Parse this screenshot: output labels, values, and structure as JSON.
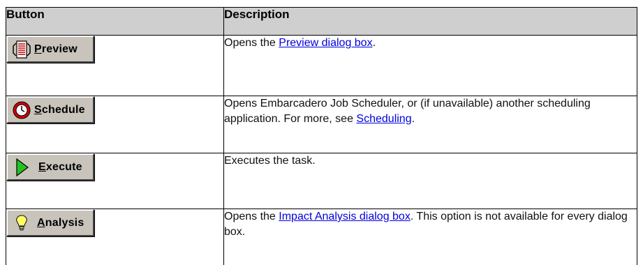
{
  "table": {
    "headers": {
      "button": "Button",
      "description": "Description"
    },
    "rows": [
      {
        "button_key": "P",
        "button_rest": "review",
        "icon": "preview-icon",
        "desc_before": "Opens the ",
        "desc_link": "Preview dialog box",
        "desc_after": "."
      },
      {
        "button_key": "S",
        "button_rest": "chedule",
        "icon": "clock-icon",
        "desc_before": "Opens Embarcadero Job Scheduler, or (if unavailable) another scheduling application. For more, see ",
        "desc_link": "Scheduling",
        "desc_after": "."
      },
      {
        "button_key": "E",
        "button_rest": "xecute",
        "icon": "play-icon",
        "desc_text": "Executes the task."
      },
      {
        "button_key": "A",
        "button_rest": "nalysis",
        "icon": "lightbulb-icon",
        "desc_before": "Opens the ",
        "desc_link": "Impact Analysis dialog box",
        "desc_after": ". This option is not available for every dialog box."
      }
    ]
  },
  "colors": {
    "header_bg": "#cfcfcf",
    "link": "#0000dd",
    "button_face": "#c8c4bc"
  }
}
